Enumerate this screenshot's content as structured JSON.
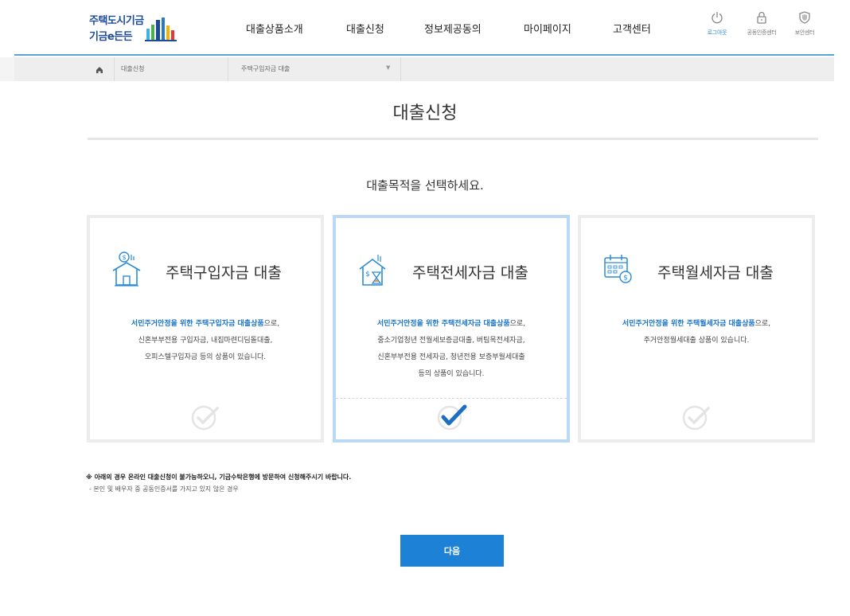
{
  "logo": {
    "line1": "주택도시기금",
    "line2": "기금e든든"
  },
  "nav": [
    "대출상품소개",
    "대출신청",
    "정보제공동의",
    "마이페이지",
    "고객센터"
  ],
  "utility": [
    {
      "label": "로그아웃",
      "icon": "power-icon"
    },
    {
      "label": "공동인증센터",
      "icon": "lock-icon"
    },
    {
      "label": "보안센터",
      "icon": "shield-icon"
    }
  ],
  "breadcrumb": {
    "home_icon": "home-icon",
    "level1": "대출신청",
    "level2": "주택구입자금 대출"
  },
  "page": {
    "title": "대출신청",
    "subtitle": "대출목적을 선택하세요."
  },
  "cards": [
    {
      "title": "주택구입자금 대출",
      "icon": "house-purchase-icon",
      "desc_highlight": "서민주거안정을 위한 주택구입자금 대출상품",
      "desc_suffix": "으로,",
      "desc_lines": [
        "신혼부부전용 구입자금, 내집마련디딤돌대출,",
        "오피스텔구입자금 등의 상품이 있습니다."
      ],
      "selected": false
    },
    {
      "title": "주택전세자금 대출",
      "icon": "house-lease-icon",
      "desc_highlight": "서민주거안정을 위한 주택전세자금 대출상품",
      "desc_suffix": "으로,",
      "desc_lines": [
        "중소기업청년 전월세보증금대출, 버팀목전세자금,",
        "신혼부부전용 전세자금, 청년전용 보증부월세대출",
        "등의 상품이 있습니다."
      ],
      "selected": true
    },
    {
      "title": "주택월세자금 대출",
      "icon": "calendar-rent-icon",
      "desc_highlight": "서민주거안정을 위한 주택월세자금 대출상품",
      "desc_suffix": "으로,",
      "desc_lines": [
        "주거안정월세대출 상품이 있습니다."
      ],
      "selected": false
    }
  ],
  "notice": {
    "main": "※ 아래의 경우 온라인 대출신청이 불가능하오니, 기금수탁은행에 방문하여 신청해주시기 바랍니다.",
    "sub": "- 본인 및 배우자 중 공동인증서를 가지고 있지 않은 경우"
  },
  "next_button": "다음",
  "colors": {
    "accent": "#1d82d6",
    "highlight_text": "#1a73c7",
    "header_line": "#5aa6d2",
    "selected_border": "#bcd9f3"
  }
}
